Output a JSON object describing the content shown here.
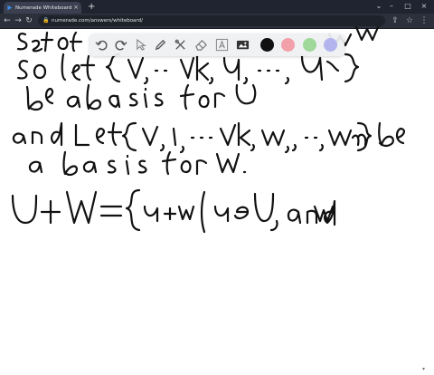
{
  "browser": {
    "tab_title": "Numerade Whiteboard",
    "url": "numerade.com/answers/whiteboard/",
    "icons": [
      "numerade-favicon",
      "close-icon",
      "new-tab-icon",
      "back-icon",
      "forward-icon",
      "reload-icon",
      "lock-icon",
      "minimize-icon",
      "maximize-icon",
      "window-close-icon"
    ]
  },
  "toolbar": {
    "tools": [
      "undo-icon",
      "redo-icon",
      "select-arrow-icon",
      "pen-icon",
      "tools-icon",
      "eraser-icon",
      "text-icon",
      "image-icon"
    ],
    "colors": [
      "#111111",
      "#f2a0aa",
      "#9fd89a",
      "#b3b3ee"
    ],
    "selected_color": "#111111"
  },
  "whiteboard": {
    "handwriting": [
      "set of vectors ... for U",
      "so let { v1, ..., vk, u1, ..., un }",
      "be a basis for U",
      "and let { v1, ..., vk, w1, ..., wm } be",
      "a basis for W.",
      "U + W = { u + w | u ∈ U, and w"
    ]
  }
}
